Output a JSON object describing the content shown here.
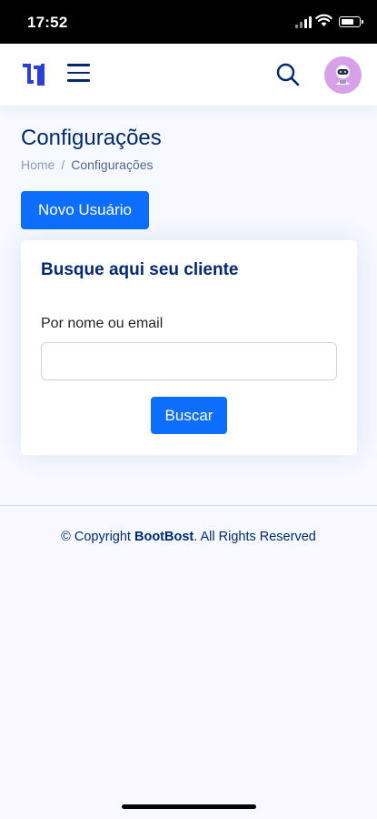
{
  "status_bar": {
    "time": "17:52"
  },
  "header": {
    "logo_icon": "brand-logo-icon",
    "menu_icon": "hamburger-menu-icon",
    "search_icon": "search-icon",
    "avatar_icon": "robot-avatar-icon"
  },
  "page": {
    "title": "Configurações",
    "breadcrumb": {
      "home": "Home",
      "separator": "/",
      "current": "Configurações"
    }
  },
  "actions": {
    "new_user_label": "Novo Usuário"
  },
  "search_card": {
    "title": "Busque aqui seu cliente",
    "field_label": "Por nome ou email",
    "field_value": "",
    "submit_label": "Buscar"
  },
  "footer": {
    "prefix": "© Copyright ",
    "brand": "BootBost",
    "suffix": ". All Rights Reserved"
  },
  "colors": {
    "primary": "#0d6efd",
    "heading": "#012970",
    "background": "#f6f9ff",
    "avatar_bg": "#d7a1ea"
  }
}
